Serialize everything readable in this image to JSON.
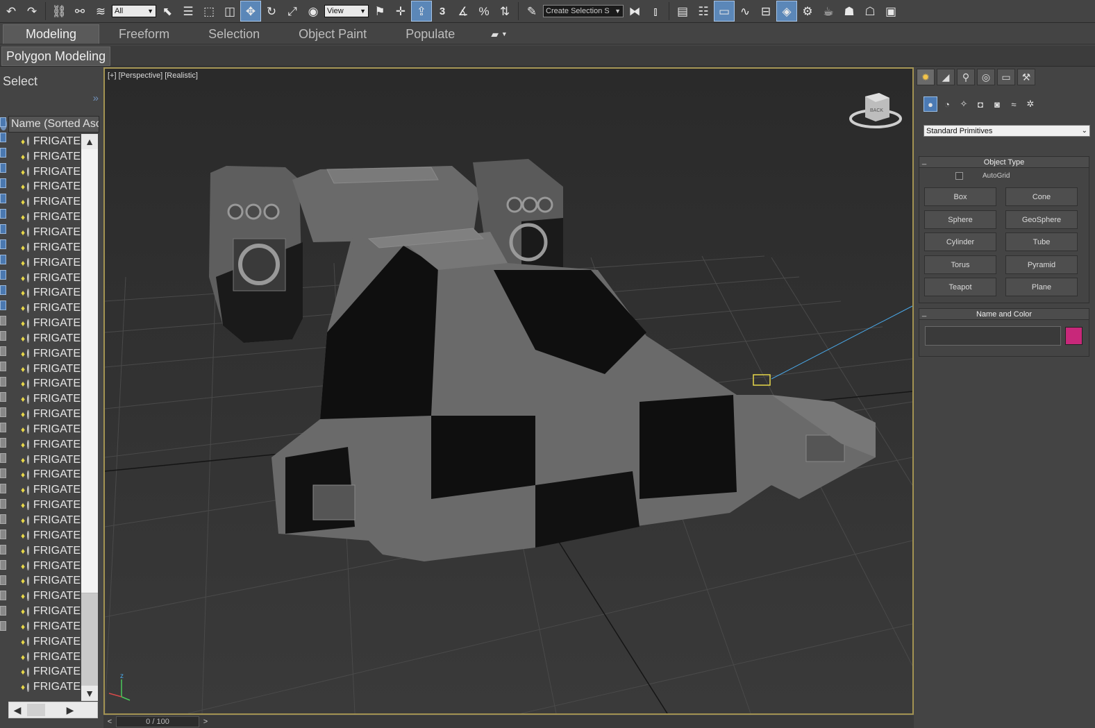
{
  "toolbar": {
    "selection_filter": "All",
    "ref_coord": "View",
    "snap_3": "3",
    "named_selection_placeholder": "Create Selection S"
  },
  "ribbon": {
    "tabs": [
      "Modeling",
      "Freeform",
      "Selection",
      "Object Paint",
      "Populate"
    ],
    "active_tab": "Modeling",
    "subtab": "Polygon Modeling"
  },
  "explorer": {
    "title": "Select",
    "column_header": "Name (Sorted Ascending)",
    "items": [
      "FRIGATE",
      "FRIGATE",
      "FRIGATE",
      "FRIGATE",
      "FRIGATE",
      "FRIGATE",
      "FRIGATE",
      "FRIGATE",
      "FRIGATE",
      "FRIGATE",
      "FRIGATE",
      "FRIGATE",
      "FRIGATE",
      "FRIGATE",
      "FRIGATE",
      "FRIGATE",
      "FRIGATE",
      "FRIGATE",
      "FRIGATE",
      "FRIGATE",
      "FRIGATE",
      "FRIGATE",
      "FRIGATE",
      "FRIGATE",
      "FRIGATE",
      "FRIGATE",
      "FRIGATE",
      "FRIGATE",
      "FRIGATE",
      "FRIGATE",
      "FRIGATE",
      "FRIGATE",
      "FRIGATE",
      "FRIGATE",
      "FRIGATE",
      "FRIGATE",
      "FRIGATE"
    ]
  },
  "viewport": {
    "label": "[+] [Perspective] [Realistic]",
    "viewcube_face": "BACK",
    "axis_z": "z"
  },
  "timeline": {
    "frame": "0 / 100",
    "prev": "<",
    "next": ">"
  },
  "command_panel": {
    "category_dropdown": "Standard Primitives",
    "object_type": {
      "title": "Object Type",
      "autogrid": "AutoGrid",
      "buttons": [
        "Box",
        "Cone",
        "Sphere",
        "GeoSphere",
        "Cylinder",
        "Tube",
        "Torus",
        "Pyramid",
        "Teapot",
        "Plane"
      ]
    },
    "name_and_color": {
      "title": "Name and Color",
      "name_value": "",
      "color": "#c8287a"
    }
  },
  "colors": {
    "viewport_border": "#a39352",
    "active_blue": "#5b87b8",
    "object_color": "#c8287a"
  }
}
